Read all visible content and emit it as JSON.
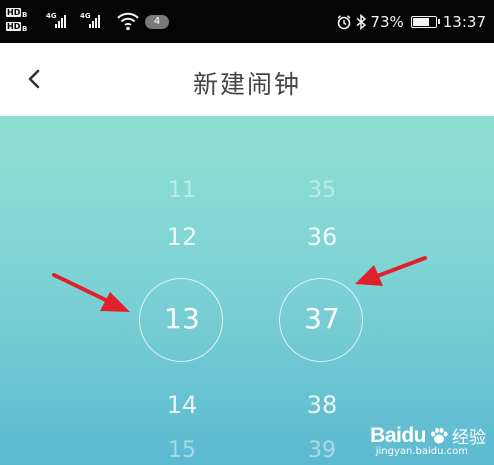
{
  "status_bar": {
    "hd_label": "HD",
    "hd_sub": "B",
    "net_1": "4G",
    "net_2": "4G",
    "notification_count": "4",
    "battery_percent": "73%",
    "battery_level": 0.73,
    "time": "13:37"
  },
  "nav": {
    "title": "新建闹钟"
  },
  "picker": {
    "hours": {
      "above_2": "11",
      "above_1": "12",
      "selected": "13",
      "below_1": "14",
      "below_2": "15"
    },
    "minutes": {
      "above_2": "35",
      "above_1": "36",
      "selected": "37",
      "below_1": "38",
      "below_2": "39"
    }
  },
  "watermark": {
    "logo": "Baidu",
    "sub": "经验",
    "url": "jingyan.baidu.com"
  },
  "colors": {
    "gradient_top": "#8edfd3",
    "gradient_bottom": "#5cb9d1",
    "arrow": "#e0202a"
  }
}
